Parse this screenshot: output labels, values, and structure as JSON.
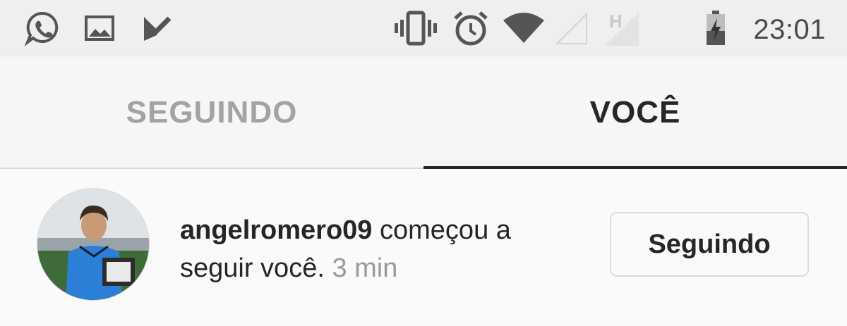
{
  "status_bar": {
    "time": "23:01",
    "icons": [
      "whatsapp-icon",
      "image-icon",
      "inbox-check-icon",
      "vibrate-icon",
      "alarm-icon",
      "wifi-icon",
      "signal-icon",
      "network-h-icon",
      "battery-charging-icon"
    ]
  },
  "tabs": {
    "following": "SEGUINDO",
    "you": "VOCÊ",
    "active": "you"
  },
  "notification": {
    "username": "angelromero09",
    "action": " começou a seguir você.",
    "time": "3 min",
    "button_label": "Seguindo"
  },
  "colors": {
    "text_primary": "#262626",
    "text_secondary": "#9a9a9a",
    "status_bar_bg": "#efefef"
  }
}
